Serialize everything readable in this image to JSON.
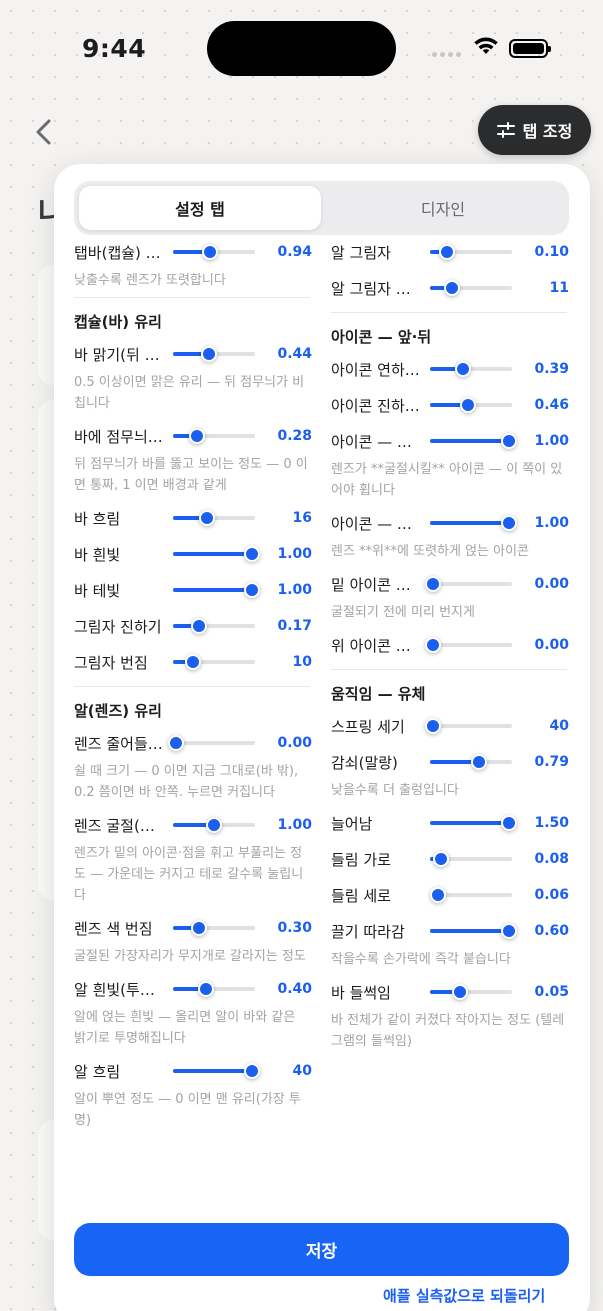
{
  "status": {
    "time": "9:44"
  },
  "background": {
    "heading": "나"
  },
  "tune_button": {
    "label": "탭 조정"
  },
  "tabs": {
    "active": "설정 탭",
    "inactive": "디자인"
  },
  "left_column": [
    {
      "kind": "slider",
      "label": "탭바(캡슐) …",
      "value": "0.94",
      "fraction": 0.45
    },
    {
      "kind": "hint",
      "text": "낮출수록 렌즈가 또렷합니다"
    },
    {
      "kind": "divider"
    },
    {
      "kind": "section",
      "text": "캡슐(바) 유리"
    },
    {
      "kind": "slider",
      "label": "바 맑기(뒤 …",
      "value": "0.44",
      "fraction": 0.44
    },
    {
      "kind": "hint",
      "text": "0.5 이상이면 맑은 유리 — 뒤 점무늬가 비칩니다"
    },
    {
      "kind": "slider",
      "label": "바에 점무늬…",
      "value": "0.28",
      "fraction": 0.28
    },
    {
      "kind": "hint",
      "text": "뒤 점무늬가 바를 뚫고 보이는 정도 — 0 이면 통짜, 1 이면 배경과 같게"
    },
    {
      "kind": "slider",
      "label": "바 흐림",
      "value": "16",
      "fraction": 0.41
    },
    {
      "kind": "slider",
      "label": "바 흰빛",
      "value": "1.00",
      "fraction": 1.0
    },
    {
      "kind": "slider",
      "label": "바 테빛",
      "value": "1.00",
      "fraction": 1.0
    },
    {
      "kind": "slider",
      "label": "그림자 진하기",
      "value": "0.17",
      "fraction": 0.3
    },
    {
      "kind": "slider",
      "label": "그림자 번짐",
      "value": "10",
      "fraction": 0.22
    },
    {
      "kind": "divider"
    },
    {
      "kind": "section",
      "text": "알(렌즈) 유리"
    },
    {
      "kind": "slider",
      "label": "렌즈 줄어들…",
      "value": "0.00",
      "fraction": 0.0
    },
    {
      "kind": "hint",
      "text": "쉴 때 크기 — 0 이면 지금 그대로(바 밖), 0.2 쯤이면 바 안쪽. 누르면 커집니다"
    },
    {
      "kind": "slider",
      "label": "렌즈 굴절(…",
      "value": "1.00",
      "fraction": 0.5
    },
    {
      "kind": "hint",
      "text": "렌즈가 밑의 아이콘·점을 휘고 부풀리는 정도 — 가운데는 커지고 테로 갈수록 눌립니다"
    },
    {
      "kind": "slider",
      "label": "렌즈 색 번짐",
      "value": "0.30",
      "fraction": 0.3
    },
    {
      "kind": "hint",
      "text": "굴절된 가장자리가 무지개로 갈라지는 정도"
    },
    {
      "kind": "slider",
      "label": "알 흰빛(투…",
      "value": "0.40",
      "fraction": 0.4
    },
    {
      "kind": "hint",
      "text": "알에 얹는 흰빛 — 올리면 알이 바와 같은 밝기로 투명해집니다"
    },
    {
      "kind": "slider",
      "label": "알 흐림",
      "value": "40",
      "fraction": 1.0
    },
    {
      "kind": "hint",
      "text": "알이 뿌연 정도 — 0 이면 맨 유리(가장 투명)"
    }
  ],
  "right_column": [
    {
      "kind": "slider",
      "label": "알 그림자",
      "value": "0.10",
      "fraction": 0.18
    },
    {
      "kind": "slider",
      "label": "알 그림자 …",
      "value": "11",
      "fraction": 0.25
    },
    {
      "kind": "divider"
    },
    {
      "kind": "section",
      "text": "아이콘 — 앞·뒤"
    },
    {
      "kind": "slider",
      "label": "아이콘 연하…",
      "value": "0.39",
      "fraction": 0.39
    },
    {
      "kind": "slider",
      "label": "아이콘 진하…",
      "value": "0.46",
      "fraction": 0.46
    },
    {
      "kind": "slider",
      "label": "아이콘 — …",
      "value": "1.00",
      "fraction": 1.0
    },
    {
      "kind": "hint",
      "text": "렌즈가 **굴절시킬** 아이콘 — 이 쪽이 있어야 휩니다"
    },
    {
      "kind": "slider",
      "label": "아이콘 — …",
      "value": "1.00",
      "fraction": 1.0
    },
    {
      "kind": "hint",
      "text": "렌즈 **위**에 또렷하게 얹는 아이콘"
    },
    {
      "kind": "slider",
      "label": "밑 아이콘 …",
      "value": "0.00",
      "fraction": 0.0
    },
    {
      "kind": "hint",
      "text": "굴절되기 전에 미리 번지게"
    },
    {
      "kind": "slider",
      "label": "위 아이콘 …",
      "value": "0.00",
      "fraction": 0.0
    },
    {
      "kind": "divider"
    },
    {
      "kind": "section",
      "text": "움직임 — 유체"
    },
    {
      "kind": "slider",
      "label": "스프링 세기",
      "value": "40",
      "fraction": 0.0
    },
    {
      "kind": "slider",
      "label": "감쇠(말랑)",
      "value": "0.79",
      "fraction": 0.6
    },
    {
      "kind": "hint",
      "text": "낮을수록 더 출렁입니다"
    },
    {
      "kind": "slider",
      "label": "늘어남",
      "value": "1.50",
      "fraction": 1.0
    },
    {
      "kind": "slider",
      "label": "들림 가로",
      "value": "0.08",
      "fraction": 0.1
    },
    {
      "kind": "slider",
      "label": "들림 세로",
      "value": "0.06",
      "fraction": 0.06
    },
    {
      "kind": "slider",
      "label": "끌기 따라감",
      "value": "0.60",
      "fraction": 1.0
    },
    {
      "kind": "hint",
      "text": "작을수록 손가락에 즉각 붙습니다"
    },
    {
      "kind": "slider",
      "label": "바 들썩임",
      "value": "0.05",
      "fraction": 0.35
    },
    {
      "kind": "hint",
      "text": "바 전체가 같이 커졌다 작아지는 정도 (텔레그램의 들썩임)"
    }
  ],
  "save_button": {
    "label": "저장"
  },
  "reset_link": {
    "label": "애플 실측값으로 되돌리기"
  },
  "colors": {
    "accent": "#1b5ff0",
    "save": "#1865f5",
    "hint": "#a3a3a8"
  }
}
